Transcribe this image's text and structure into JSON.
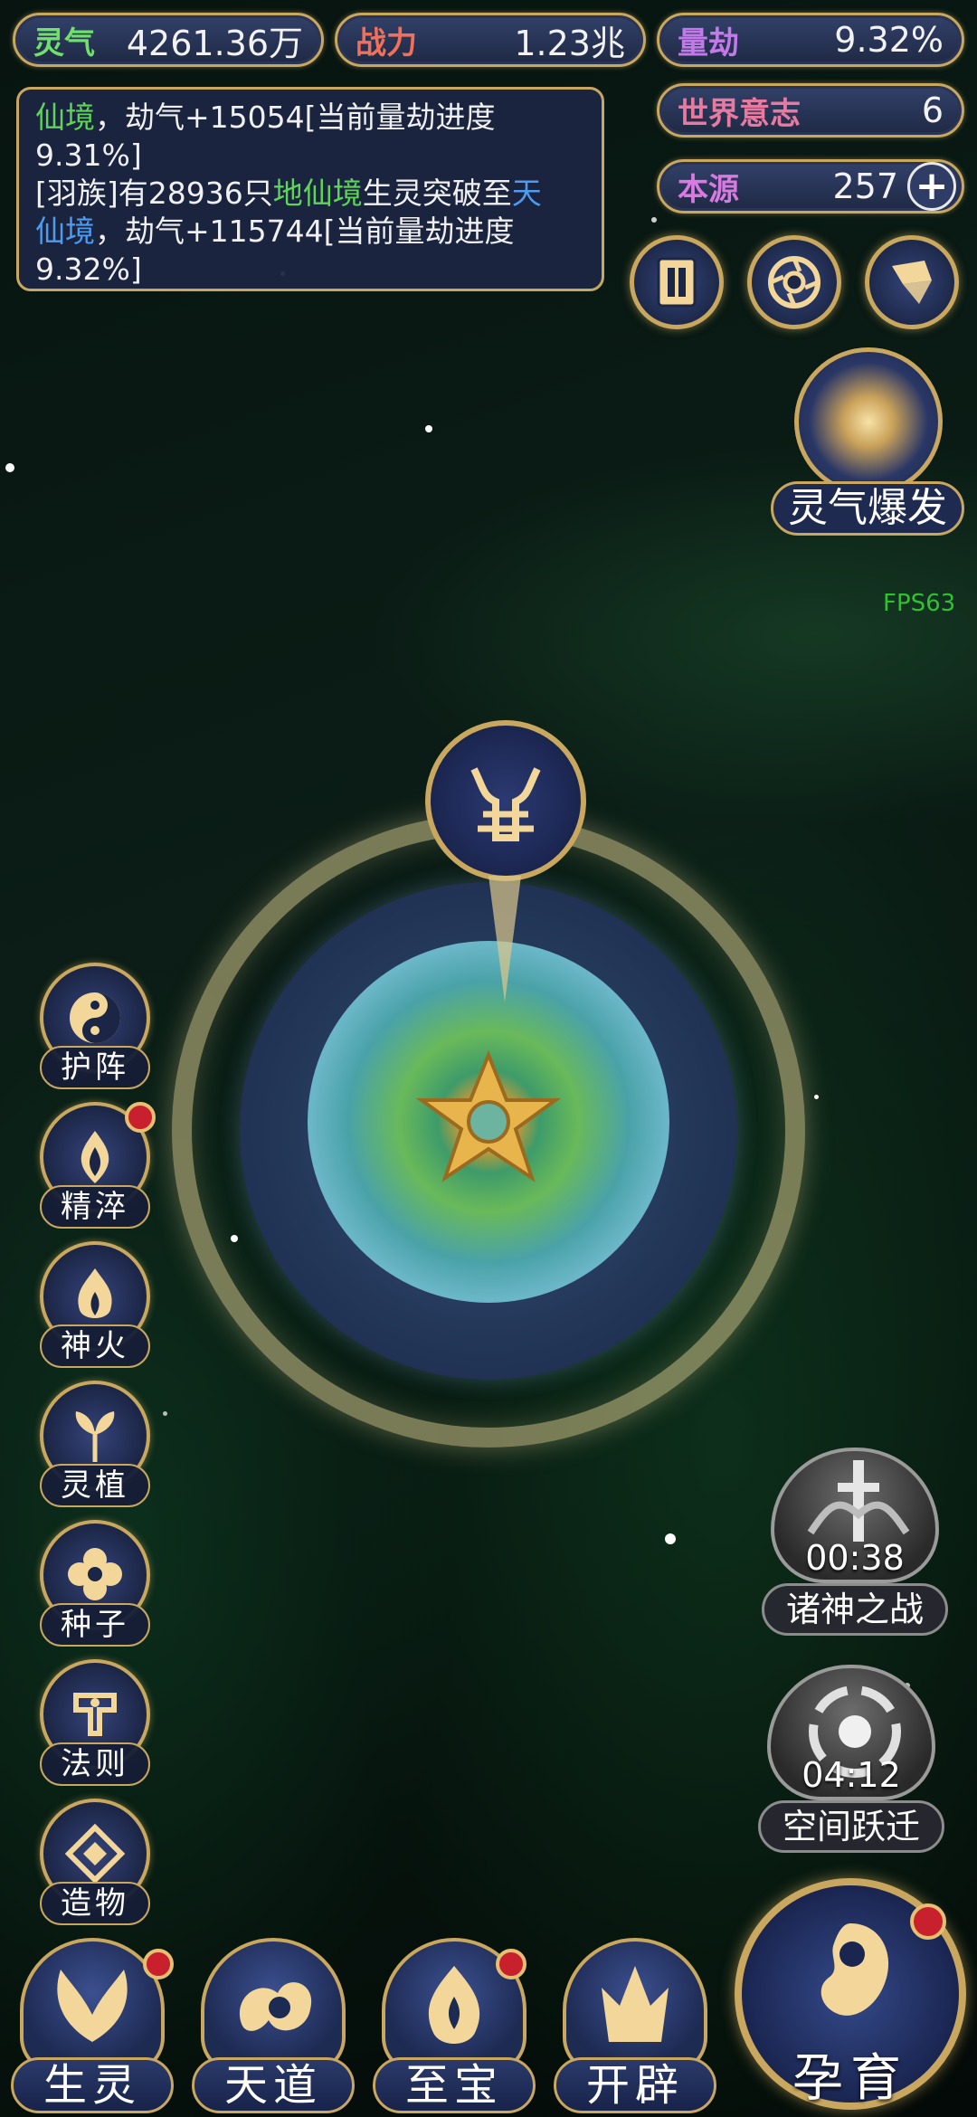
{
  "top_stats": {
    "lingqi": {
      "label": "灵气",
      "value": "4261.36万"
    },
    "zhanli": {
      "label": "战力",
      "value": "1.23兆"
    },
    "liangjie": {
      "label": "量劫",
      "value": "9.32%"
    },
    "world_will": {
      "label": "世界意志",
      "value": "6"
    },
    "benyuan": {
      "label": "本源",
      "value": "257"
    }
  },
  "log": {
    "line1": {
      "realm": "仙境",
      "gain": "，劫气+15054[当前量劫进度",
      "progress": "9.31%]"
    },
    "line2": {
      "prefix": "[羽族]有28936只",
      "realm_from": "地仙境",
      "middle": "生灵突破至",
      "realm_to_a": "天",
      "realm_to_b": "仙境",
      "gain": "，劫气+115744[当前量劫进度",
      "progress": "9.32%]"
    }
  },
  "fps": "FPS63",
  "burst_button": {
    "label": "灵气爆发"
  },
  "side_menu": [
    {
      "label": "护阵",
      "icon": "yin-yang-icon",
      "badge": false
    },
    {
      "label": "精淬",
      "icon": "flame-lotus-icon",
      "badge": true
    },
    {
      "label": "神火",
      "icon": "divine-fire-icon",
      "badge": false
    },
    {
      "label": "灵植",
      "icon": "spirit-plant-icon",
      "badge": false
    },
    {
      "label": "种子",
      "icon": "flower-seed-icon",
      "badge": false
    },
    {
      "label": "法则",
      "icon": "law-rune-icon",
      "badge": false
    },
    {
      "label": "造物",
      "icon": "creation-diamond-icon",
      "badge": false
    }
  ],
  "events": [
    {
      "label": "诸神之战",
      "timer": "00:38",
      "icon": "sword-emblem-icon"
    },
    {
      "label": "空间跃迁",
      "timer": "04:12",
      "icon": "vortex-icon"
    }
  ],
  "bottom_nav": [
    {
      "label": "生灵",
      "icon": "phoenix-icon",
      "badge": true
    },
    {
      "label": "天道",
      "icon": "cloud-swirl-icon",
      "badge": false
    },
    {
      "label": "至宝",
      "icon": "treasure-flame-icon",
      "badge": true
    },
    {
      "label": "开辟",
      "icon": "crystal-peak-icon",
      "badge": false
    }
  ],
  "incubate": {
    "label": "孕育",
    "badge": true
  },
  "colors": {
    "gold": "#c9a75e",
    "panel": "#1f2944",
    "green_text": "#5fd35a",
    "blue_text": "#4f9bf0",
    "badge_red": "#c8202c"
  }
}
